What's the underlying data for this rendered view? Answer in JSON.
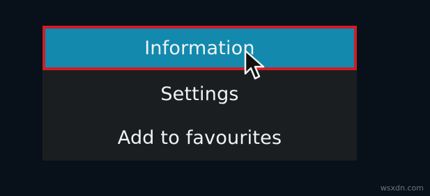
{
  "menu": {
    "items": [
      {
        "label": "Information",
        "selected": true
      },
      {
        "label": "Settings",
        "selected": false
      },
      {
        "label": "Add to favourites",
        "selected": false
      }
    ],
    "colors": {
      "background": "#1b1e20",
      "selected_background": "#1289ad",
      "highlight_border": "#d31b26",
      "text": "#f1f3f4"
    }
  },
  "cursor": {
    "icon": "mouse-pointer-icon"
  },
  "watermark": {
    "text": "wsxdn.com"
  }
}
